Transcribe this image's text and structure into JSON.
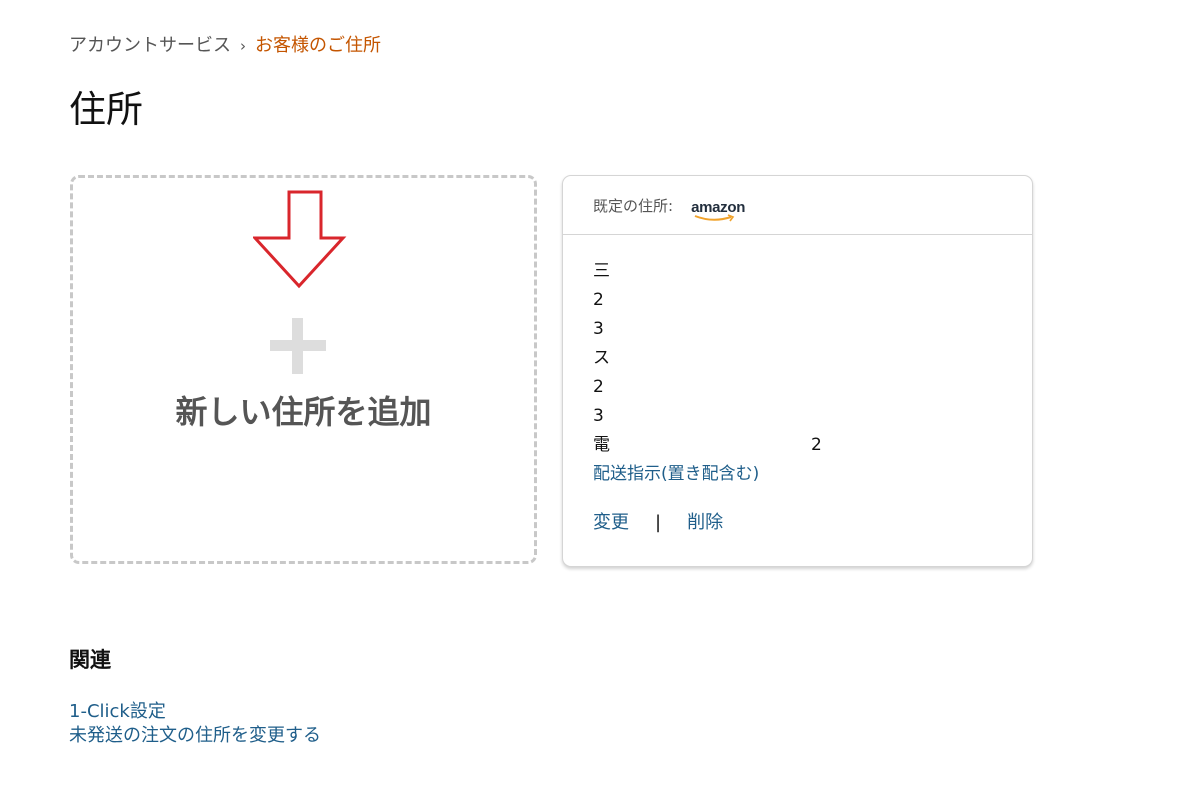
{
  "breadcrumb": {
    "account_services": "アカウントサービス",
    "separator": "›",
    "current": "お客様のご住所"
  },
  "page_title": "住所",
  "add_card": {
    "label": "新しい住所を追加",
    "plus_icon": "plus-icon",
    "annotation_icon": "red-down-arrow-icon"
  },
  "default_address": {
    "header_label": "既定の住所:",
    "logo_text": "amazon",
    "lines": [
      "三",
      "2",
      "3",
      "ス",
      "2",
      "3",
      "電"
    ],
    "last_line_suffix": "2",
    "delivery_instructions_link": "配送指示(置き配含む)",
    "edit_label": "変更",
    "action_separator": "|",
    "delete_label": "削除"
  },
  "related": {
    "heading": "関連",
    "links": [
      "1-Click設定",
      "未発送の注文の住所を変更する"
    ]
  },
  "colors": {
    "link": "#1f5e8a",
    "breadcrumb_current": "#c45500",
    "annotation_arrow": "#d9262c",
    "card_border": "#d5d5d5",
    "dashed_border": "#c8c8c8"
  }
}
